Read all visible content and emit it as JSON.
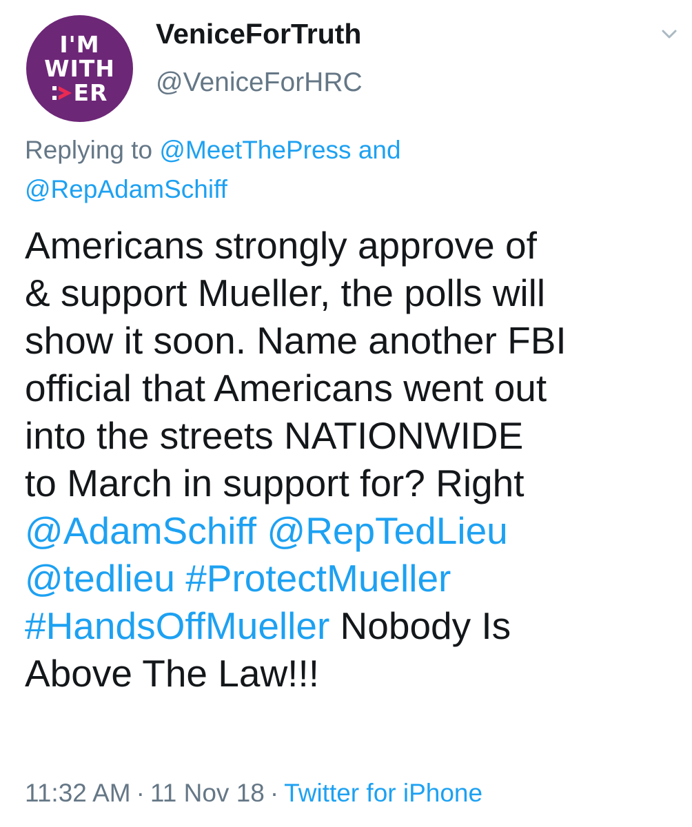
{
  "avatar": {
    "line1": "I'M",
    "line2": "WITH",
    "line3": "ER",
    "background": "#6d2777"
  },
  "user": {
    "display_name": "VeniceForTruth",
    "handle": "@VeniceForHRC"
  },
  "reply": {
    "prefix": "Replying to ",
    "mention1": "@MeetThePress",
    "conjunction": " and",
    "mention2": "@RepAdamSchiff"
  },
  "tweet": {
    "line1": "Americans strongly approve of",
    "line2": "& support Mueller, the polls will",
    "line3": "show it soon. Name another FBI",
    "line4": "official that Americans went out",
    "line5": "into the streets NATIONWIDE",
    "line6": "to March in support for? Right",
    "mention_adamschiff": "@AdamSchiff",
    "mention_reptedlieu": "@RepTedLieu",
    "mention_tedlieu": "@tedlieu",
    "hashtag_protect": "#ProtectMueller",
    "hashtag_handsoff": "#HandsOffMueller",
    "tail1": " Nobody Is",
    "tail2": "Above The Law!!!"
  },
  "meta": {
    "time": "11:32 AM",
    "separator": "·",
    "date": "11 Nov 18",
    "source": "Twitter for iPhone"
  },
  "colors": {
    "link": "#1da1f2",
    "text": "#14171a",
    "secondary": "#657786"
  },
  "icons": {
    "menu": "chevron-down-icon",
    "logo_arrow": "arrow-right-icon"
  }
}
